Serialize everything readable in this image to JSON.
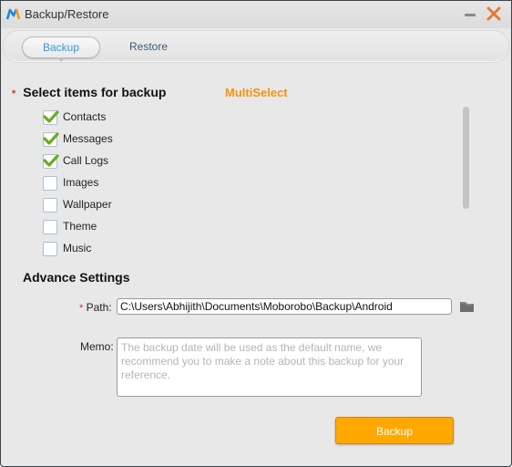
{
  "window": {
    "title": "Backup/Restore",
    "controls": {
      "minimize": "minimize",
      "close": "close"
    }
  },
  "tabs": [
    {
      "label": "Backup",
      "active": true
    },
    {
      "label": "Restore",
      "active": false
    }
  ],
  "select_section": {
    "required_mark": "*",
    "title": "Select items for backup",
    "multiselect_label": "MultiSelect",
    "items": [
      {
        "label": "Contacts",
        "checked": true
      },
      {
        "label": "Messages",
        "checked": true
      },
      {
        "label": "Call Logs",
        "checked": true
      },
      {
        "label": "Images",
        "checked": false
      },
      {
        "label": "Wallpaper",
        "checked": false
      },
      {
        "label": "Theme",
        "checked": false
      },
      {
        "label": "Music",
        "checked": false
      }
    ]
  },
  "advance_settings": {
    "title": "Advance Settings",
    "path": {
      "required_mark": "*",
      "label": "Path:",
      "value": "C:\\Users\\Abhijith\\Documents\\Moborobo\\Backup\\Android"
    },
    "memo": {
      "label": "Memo:",
      "value": "",
      "placeholder": "The backup date will be used as the default name, we recommend you to make a note about this backup for your reference."
    }
  },
  "actions": {
    "backup_label": "Backup"
  },
  "colors": {
    "accent_orange": "#f29211",
    "button_orange": "#ffa800",
    "active_tab_blue": "#3399d9",
    "check_green": "#6aac1d"
  }
}
